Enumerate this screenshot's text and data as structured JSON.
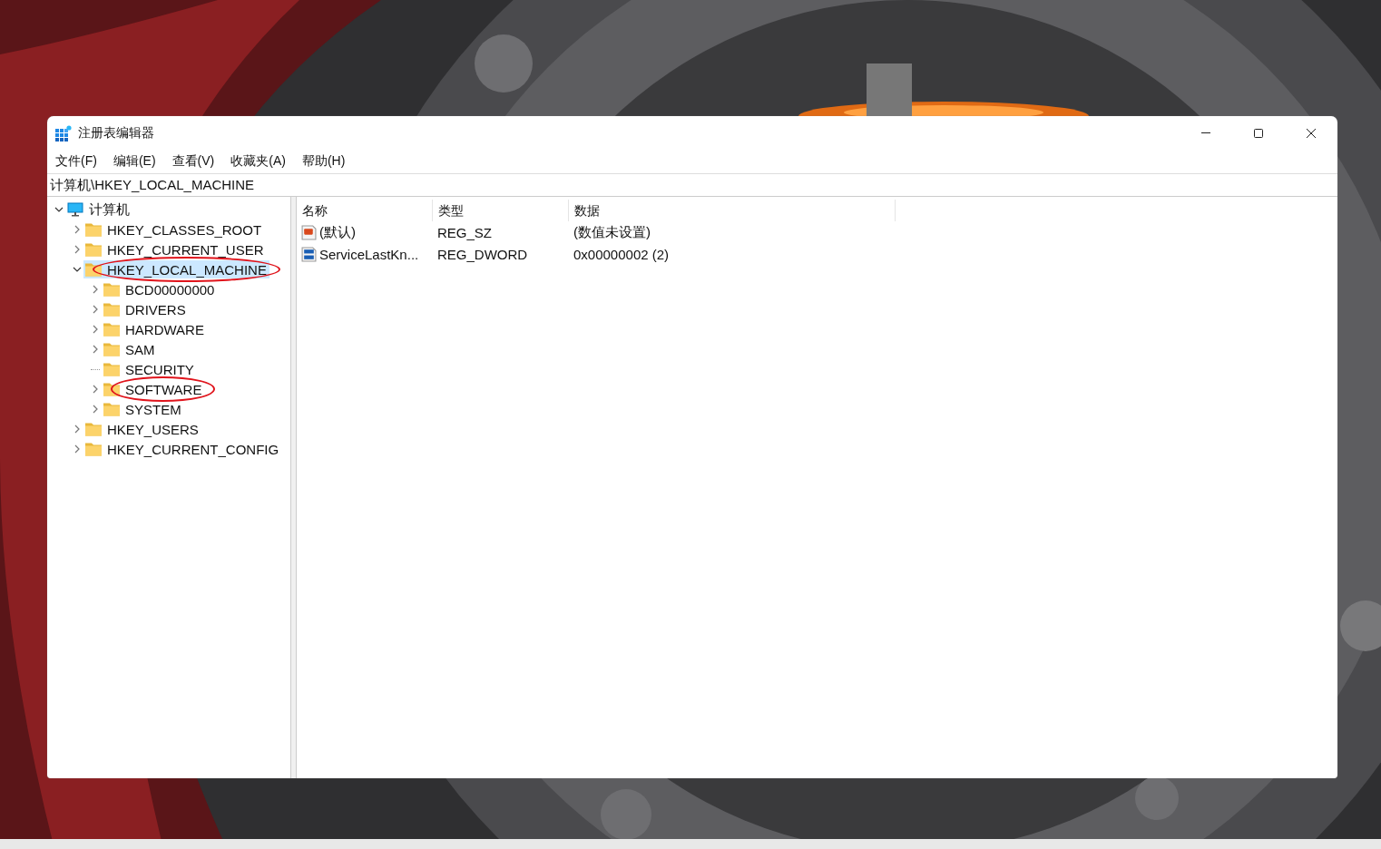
{
  "window": {
    "title": "注册表编辑器"
  },
  "menu": [
    "文件(F)",
    "编辑(E)",
    "查看(V)",
    "收藏夹(A)",
    "帮助(H)"
  ],
  "address": "计算机\\HKEY_LOCAL_MACHINE",
  "tree": [
    {
      "label": "计算机",
      "kind": "computer",
      "expanded": true,
      "selected": false,
      "children": [
        {
          "label": "HKEY_CLASSES_ROOT",
          "kind": "folder",
          "expanded": false,
          "selected": false
        },
        {
          "label": "HKEY_CURRENT_USER",
          "kind": "folder",
          "expanded": false,
          "selected": false
        },
        {
          "label": "HKEY_LOCAL_MACHINE",
          "kind": "folder",
          "expanded": true,
          "selected": true,
          "circled": true,
          "children": [
            {
              "label": "BCD00000000",
              "kind": "folder",
              "expanded": false,
              "selected": false
            },
            {
              "label": "DRIVERS",
              "kind": "folder",
              "expanded": false,
              "selected": false
            },
            {
              "label": "HARDWARE",
              "kind": "folder",
              "expanded": false,
              "selected": false
            },
            {
              "label": "SAM",
              "kind": "folder",
              "expanded": false,
              "selected": false
            },
            {
              "label": "SECURITY",
              "kind": "folder",
              "expandable": false,
              "selected": false
            },
            {
              "label": "SOFTWARE",
              "kind": "folder",
              "expanded": false,
              "selected": false,
              "circled": true
            },
            {
              "label": "SYSTEM",
              "kind": "folder",
              "expanded": false,
              "selected": false
            }
          ]
        },
        {
          "label": "HKEY_USERS",
          "kind": "folder",
          "expanded": false,
          "selected": false
        },
        {
          "label": "HKEY_CURRENT_CONFIG",
          "kind": "folder",
          "expanded": false,
          "selected": false
        }
      ]
    }
  ],
  "list": {
    "columns": [
      "名称",
      "类型",
      "数据"
    ],
    "rows": [
      {
        "kind": "string",
        "name": "(默认)",
        "type": "REG_SZ",
        "data": "(数值未设置)"
      },
      {
        "kind": "binary",
        "name": "ServiceLastKn...",
        "type": "REG_DWORD",
        "data": "0x00000002 (2)"
      }
    ]
  }
}
